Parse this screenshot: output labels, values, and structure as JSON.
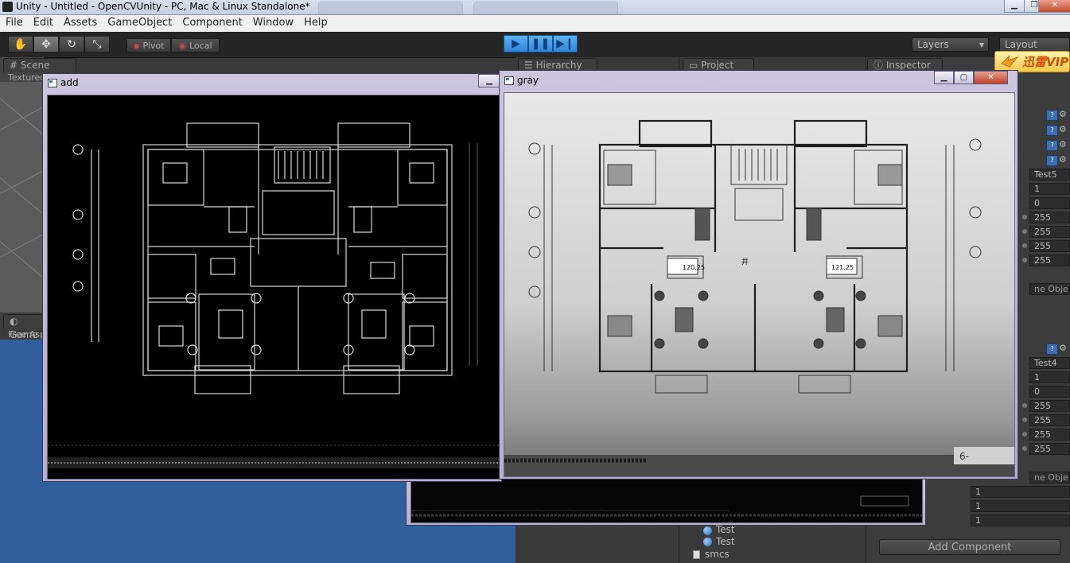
{
  "window": {
    "title": "Unity - Untitled - OpenCVUnity - PC, Mac & Linux Standalone*",
    "minimize": "▁",
    "maximize": "❐",
    "close": "✕"
  },
  "menu": [
    "File",
    "Edit",
    "Assets",
    "GameObject",
    "Component",
    "Window",
    "Help"
  ],
  "toolbar": {
    "pivot": "Pivot",
    "local": "Local",
    "layers": "Layers",
    "layout": "Layout"
  },
  "tabs": {
    "scene": "Scene",
    "scene_sub": "Textured",
    "game": "Game",
    "game_sub": "Free Aspect",
    "hierarchy": "Hierarchy",
    "project": "Project",
    "inspector": "Inspector"
  },
  "xunlei_badge": "迅雷VIP",
  "cv_windows": {
    "add_title": "add",
    "gray_title": "gray"
  },
  "inspector": {
    "component1_name": "Test5",
    "component1_values": [
      "1",
      "0",
      "255",
      "255",
      "255",
      "255"
    ],
    "component1_footer": "ne Obje",
    "component2_name": "Test4",
    "component2_values": [
      "1",
      "0",
      "255",
      "255",
      "255",
      "255"
    ],
    "component2_footer": "ne Obje",
    "extra_values": [
      "1",
      "1",
      "1"
    ],
    "add_component": "Add Component"
  },
  "project": {
    "items": [
      "Test",
      "Test",
      "smcs"
    ]
  },
  "floorplan_labels": {
    "area_left": "120.25",
    "area_right": "121.25",
    "shaft_label": "井",
    "bottom_corner": "6-"
  }
}
